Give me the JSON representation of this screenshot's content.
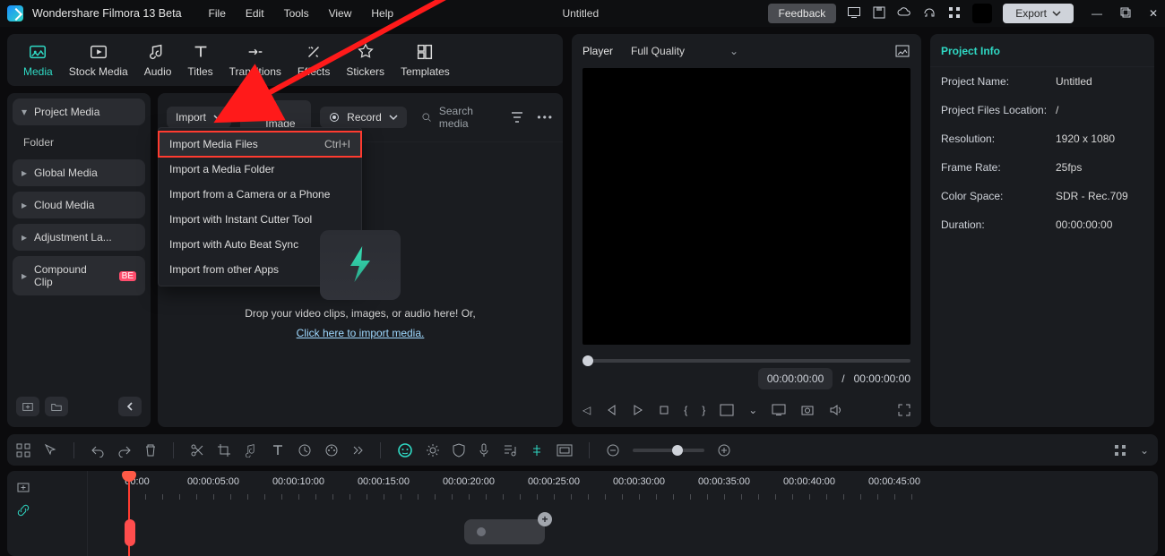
{
  "app": {
    "name": "Wondershare Filmora 13 Beta",
    "title": "Untitled"
  },
  "menubar": {
    "file": "File",
    "edit": "Edit",
    "tools": "Tools",
    "view": "View",
    "help": "Help"
  },
  "titlebar_buttons": {
    "feedback": "Feedback",
    "export": "Export"
  },
  "tabs": {
    "media": "Media",
    "stock": "Stock Media",
    "audio": "Audio",
    "titles": "Titles",
    "transitions": "Transitions",
    "effects": "Effects",
    "stickers": "Stickers",
    "templates": "Templates"
  },
  "sidebar": {
    "project_media": "Project Media",
    "folder": "Folder",
    "global": "Global Media",
    "cloud": "Cloud Media",
    "adjustment": "Adjustment La...",
    "compound": "Compound Clip"
  },
  "toolbar": {
    "import": "Import",
    "ai_image": "AI Image",
    "record": "Record",
    "search_placeholder": "Search media"
  },
  "import_menu": {
    "files": "Import Media Files",
    "files_shortcut": "Ctrl+I",
    "folder": "Import a Media Folder",
    "camera": "Import from a Camera or a Phone",
    "instant": "Import with Instant Cutter Tool",
    "beat": "Import with Auto Beat Sync",
    "other": "Import from other Apps"
  },
  "dropzone": {
    "text": "Drop your video clips, images, or audio here! Or,",
    "link": "Click here to import media."
  },
  "player": {
    "label": "Player",
    "quality": "Full Quality",
    "current": "00:00:00:00",
    "sep": "/",
    "total": "00:00:00:00"
  },
  "info": {
    "tab": "Project Info",
    "name_k": "Project Name:",
    "name_v": "Untitled",
    "loc_k": "Project Files Location:",
    "loc_v": "/",
    "res_k": "Resolution:",
    "res_v": "1920 x 1080",
    "fps_k": "Frame Rate:",
    "fps_v": "25fps",
    "cs_k": "Color Space:",
    "cs_v": "SDR - Rec.709",
    "dur_k": "Duration:",
    "dur_v": "00:00:00:00"
  },
  "ruler": {
    "t0": "00:00",
    "t1": "00:00:05:00",
    "t2": "00:00:10:00",
    "t3": "00:00:15:00",
    "t4": "00:00:20:00",
    "t5": "00:00:25:00",
    "t6": "00:00:30:00",
    "t7": "00:00:35:00",
    "t8": "00:00:40:00",
    "t9": "00:00:45:00"
  }
}
